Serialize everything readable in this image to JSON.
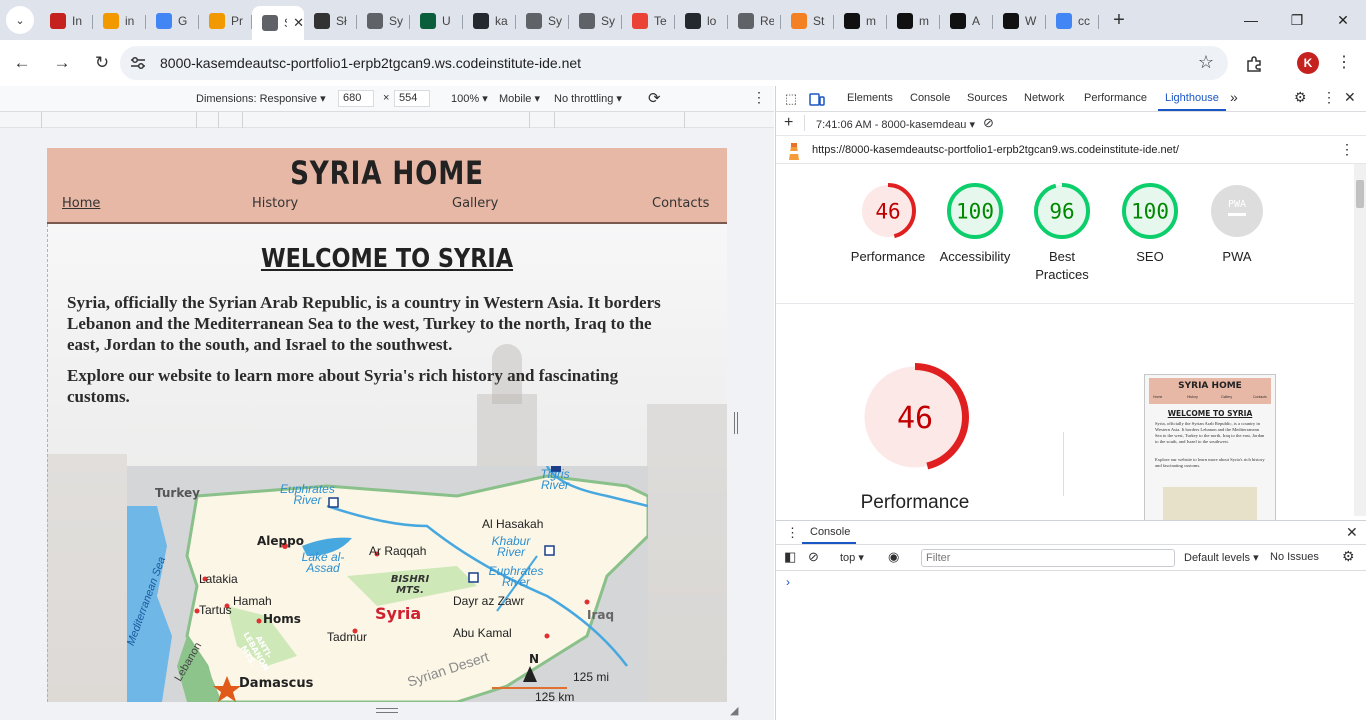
{
  "browser": {
    "tabs": [
      {
        "label": "In",
        "icon": "gmail-icon",
        "color": "#c5221f"
      },
      {
        "label": "in",
        "icon": "g-logo-icon",
        "color": "#f29900"
      },
      {
        "label": "G",
        "icon": "google-translate-icon",
        "color": "#4285f4"
      },
      {
        "label": "Pr",
        "icon": "g-logo-icon",
        "color": "#f29900"
      },
      {
        "label": "Sy",
        "icon": "globe-icon",
        "color": "#5f6368",
        "active": true
      },
      {
        "label": "Sł",
        "icon": "bolt-icon",
        "color": "#333333"
      },
      {
        "label": "Sy",
        "icon": "globe-icon",
        "color": "#5f6368"
      },
      {
        "label": "U",
        "icon": "d-logo-icon",
        "color": "#0b5e3c"
      },
      {
        "label": "ka",
        "icon": "github-icon",
        "color": "#24292f"
      },
      {
        "label": "Sy",
        "icon": "globe-icon",
        "color": "#5f6368"
      },
      {
        "label": "Sy",
        "icon": "globe-icon",
        "color": "#5f6368"
      },
      {
        "label": "Te",
        "icon": "circle-o-icon",
        "color": "#ea4335"
      },
      {
        "label": "lo",
        "icon": "github-icon",
        "color": "#24292f"
      },
      {
        "label": "Re",
        "icon": "globe-icon",
        "color": "#5f6368"
      },
      {
        "label": "St",
        "icon": "stackoverflow-icon",
        "color": "#f48024"
      },
      {
        "label": "m",
        "icon": "m-logo-icon",
        "color": "#111111"
      },
      {
        "label": "m",
        "icon": "m-logo-icon",
        "color": "#111111"
      },
      {
        "label": "A",
        "icon": "ud-logo-icon",
        "color": "#111111"
      },
      {
        "label": "W",
        "icon": "w-logo-icon",
        "color": "#111111"
      },
      {
        "label": "cc",
        "icon": "google-icon",
        "color": "#4285f4"
      }
    ],
    "new_tab": "+",
    "url": "8000-kasemdeautsc-portfolio1-erpb2tgcan9.ws.codeinstitute-ide.net",
    "profile_initial": "K",
    "accent": "#1a56c4"
  },
  "device_toolbar": {
    "dimensions": "Dimensions: Responsive",
    "width": "680",
    "times": "×",
    "height": "554",
    "zoom": "100%",
    "mode": "Mobile",
    "throttling": "No throttling"
  },
  "site": {
    "title": "SYRIA HOME",
    "nav": [
      "Home",
      "History",
      "Gallery",
      "Contacts"
    ],
    "welcome": "WELCOME TO SYRIA",
    "para1": "Syria, officially the Syrian Arab Republic, is a country in Western Asia. It borders Lebanon and the Mediterranean Sea to the west, Turkey to the north, Iraq to the east, Jordan to the south, and Israel to the southwest.",
    "para2": "Explore our website to learn more about Syria's rich history and fascinating customs.",
    "header_color": "#e8b8a6",
    "map_labels": {
      "turkey": "Turkey",
      "euphrates_top": "Euphrates River",
      "tigris": "Tigris River",
      "al_hasakah": "Al Hasakah",
      "aleppo": "Aleppo",
      "ar_raqqah": "Ar Raqqah",
      "khabur": "Khabur River",
      "lake": "Lake al-Assad",
      "mediterranean": "Mediterranean Sea",
      "latakia": "Latakia",
      "bishri": "BISHRI MTS.",
      "euphrates_bottom": "Euphrates River",
      "hamah": "Hamah",
      "tartus": "Tartus",
      "homs": "Homs",
      "syria": "Syria",
      "dayr": "Dayr az Zawr",
      "iraq": "Iraq",
      "anti_lebanon": "ANTI-LEBANON MTS.",
      "tadmur": "Tadmur",
      "abu_kamal": "Abu Kamal",
      "lebanon": "Lebanon",
      "damascus": "Damascus",
      "syrian_desert": "Syrian Desert",
      "north": "N",
      "scale_mi": "125 mi",
      "scale_km": "125 km"
    }
  },
  "devtools": {
    "tabs": [
      "Elements",
      "Console",
      "Sources",
      "Network",
      "Performance",
      "Lighthouse"
    ],
    "active_tab": "Lighthouse",
    "report_time": "7:41:06 AM - 8000-kasemdeau",
    "report_url": "https://8000-kasemdeautsc-portfolio1-erpb2tgcan9.ws.codeinstitute-ide.net/",
    "scores": [
      {
        "label": "Performance",
        "value": "46",
        "score": 46,
        "color": "#e02020",
        "bg": "#fde8e8",
        "text_color": "#c00000"
      },
      {
        "label": "Accessibility",
        "value": "100",
        "score": 100,
        "color": "#0cce6b",
        "bg": "#e6f8ee",
        "text_color": "#008800"
      },
      {
        "label": "Best Practices",
        "value": "96",
        "score": 96,
        "color": "#0cce6b",
        "bg": "#e6f8ee",
        "text_color": "#008800"
      },
      {
        "label": "SEO",
        "value": "100",
        "score": 100,
        "color": "#0cce6b",
        "bg": "#e6f8ee",
        "text_color": "#008800"
      },
      {
        "label": "PWA",
        "value": "PWA",
        "score": 0,
        "color": "#dddddd",
        "bg": "#dddddd",
        "text_color": "#ffffff"
      }
    ],
    "big_score": {
      "label": "Performance",
      "value": "46",
      "score": 46
    },
    "thumb": {
      "title": "SYRIA HOME",
      "nav": [
        "Home",
        "History",
        "Gallery",
        "Contacts"
      ],
      "welcome": "WELCOME TO SYRIA",
      "para1": "Syria, officially the Syrian Arab Republic, is a country in Western Asia. It borders Lebanon and the Mediterranean Sea to the west, Turkey to the north, Iraq to the east, Jordan to the south, and Israel to the southwest.",
      "para2": "Explore our website to learn more about Syria's rich history and fascinating customs."
    },
    "drawer": {
      "tab": "Console",
      "context": "top",
      "filter_placeholder": "Filter",
      "levels": "Default levels",
      "issues": "No Issues",
      "prompt": "›"
    }
  }
}
